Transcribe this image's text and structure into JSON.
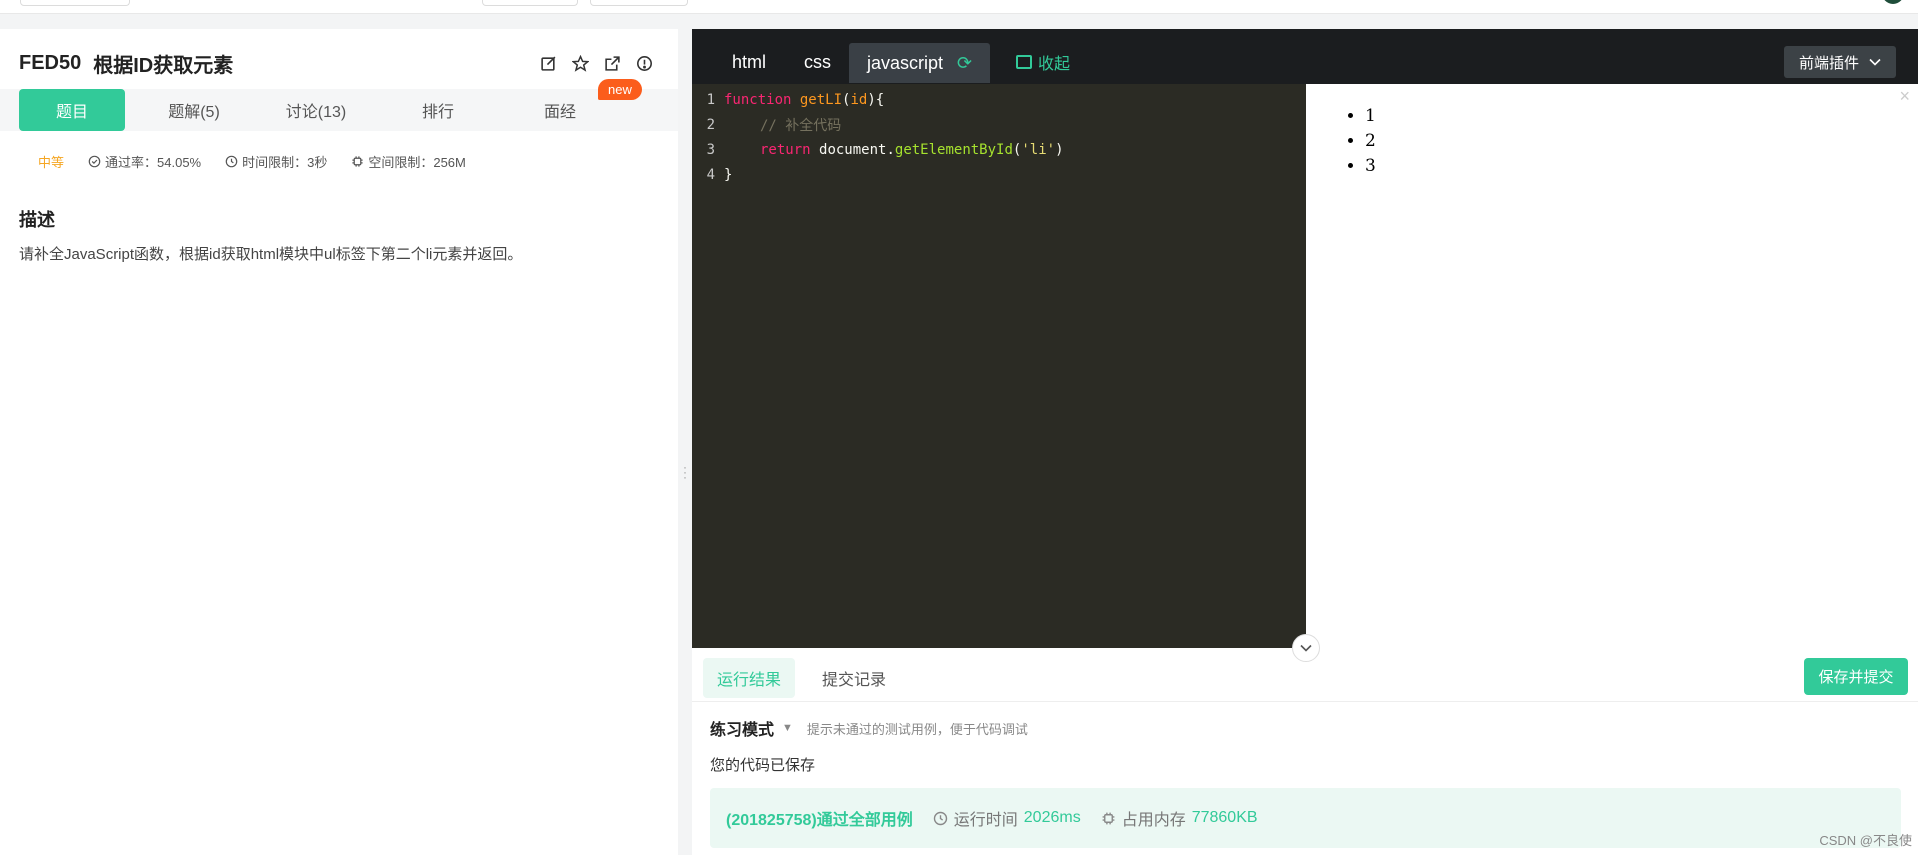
{
  "problem": {
    "id": "FED50",
    "title": "根据ID获取元素",
    "tabs": [
      {
        "label": "题目"
      },
      {
        "label": "题解(5)"
      },
      {
        "label": "讨论(13)"
      },
      {
        "label": "排行"
      },
      {
        "label": "面经"
      }
    ],
    "new_badge": "new",
    "difficulty": "中等",
    "pass_rate": "通过率：54.05%",
    "time_limit": "时间限制：3秒",
    "space_limit": "空间限制：256M",
    "description_heading": "描述",
    "description": "请补全JavaScript函数，根据id获取html模块中ul标签下第二个li元素并返回。"
  },
  "editor": {
    "file_tabs": [
      {
        "label": "html"
      },
      {
        "label": "css"
      },
      {
        "label": "javascript"
      }
    ],
    "collapse_label": "收起",
    "plugin_label": "前端插件",
    "code_lines": [
      {
        "n": "1"
      },
      {
        "n": "2",
        "text": "// 补全代码"
      },
      {
        "n": "3"
      },
      {
        "n": "4",
        "text": "}"
      }
    ],
    "code_tokens": {
      "l1_kw": "function",
      "l1_fn": "getLI",
      "l1_p1": "(",
      "l1_arg": "id",
      "l1_p2": "){",
      "l3_kw": "return",
      "l3_obj": "document",
      "l3_dot": ".",
      "l3_method": "getElementById",
      "l3_p1": "(",
      "l3_str": "'li'",
      "l3_p2": ")"
    }
  },
  "preview": {
    "items": [
      "1",
      "2",
      "3"
    ],
    "close": "×"
  },
  "result": {
    "tabs": [
      {
        "label": "运行结果"
      },
      {
        "label": "提交记录"
      }
    ],
    "submit_label": "保存并提交",
    "mode_label": "练习模式",
    "mode_hint": "提示未通过的测试用例，便于代码调试",
    "saved_msg": "您的代码已保存",
    "pass_msg": "(201825758)通过全部用例",
    "runtime_label": "运行时间",
    "runtime_value": "2026ms",
    "memory_label": "占用内存",
    "memory_value": "77860KB"
  },
  "watermark": "CSDN @不良使",
  "colors": {
    "accent": "#32ca99",
    "badge": "#fb5d1c",
    "difficulty": "#f5a623",
    "editor_bg": "#2b2b24",
    "editor_bar": "#1b1d1f"
  }
}
